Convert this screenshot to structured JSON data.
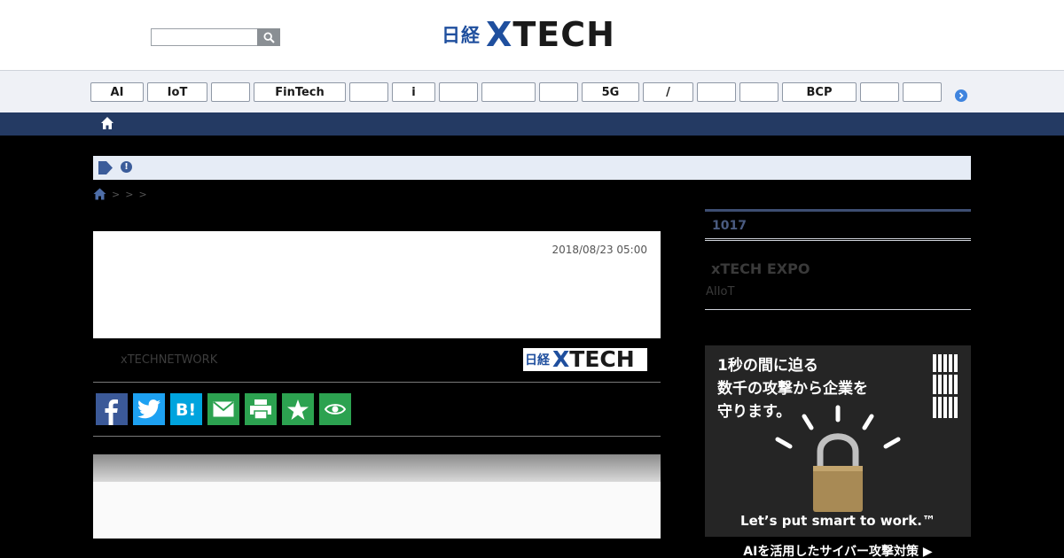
{
  "header": {
    "search_placeholder": "",
    "logo_nikkei": "日経",
    "logo_x": "X",
    "logo_tech": "TECH"
  },
  "tags": [
    "AI",
    "IoT",
    "",
    "FinTech",
    "",
    "i",
    "",
    "",
    "",
    "5G",
    "/",
    "",
    "",
    "BCP",
    "",
    ""
  ],
  "article": {
    "date": "2018/08/23 05:00",
    "author": "xTECHNETWORK",
    "source_logo_nikkei": "日経",
    "source_logo_x": "X",
    "source_logo_tech": "TECH"
  },
  "breadcrumb": {
    "separators": [
      ">",
      ">",
      ">"
    ]
  },
  "share_buttons": [
    {
      "name": "facebook",
      "color": "#3b5998"
    },
    {
      "name": "twitter",
      "color": "#1da1f2"
    },
    {
      "name": "hatena",
      "color": "#00a4de"
    },
    {
      "name": "mail",
      "color": "#2ca250"
    },
    {
      "name": "print",
      "color": "#2ca250"
    },
    {
      "name": "star",
      "color": "#2ca250"
    },
    {
      "name": "eye",
      "color": "#2ca250"
    }
  ],
  "sidebar": {
    "ranking_label": "1017",
    "expo_title": "xTECH EXPO",
    "expo_sub": "AIIoT"
  },
  "ad": {
    "line1": "1秒の間に迫る",
    "line2": "数千の攻撃から企業を",
    "line3": "守ります。",
    "tagline": "Let’s put smart to work.™",
    "caption": "AIを活用したサイバー攻撃対策 ▶"
  }
}
